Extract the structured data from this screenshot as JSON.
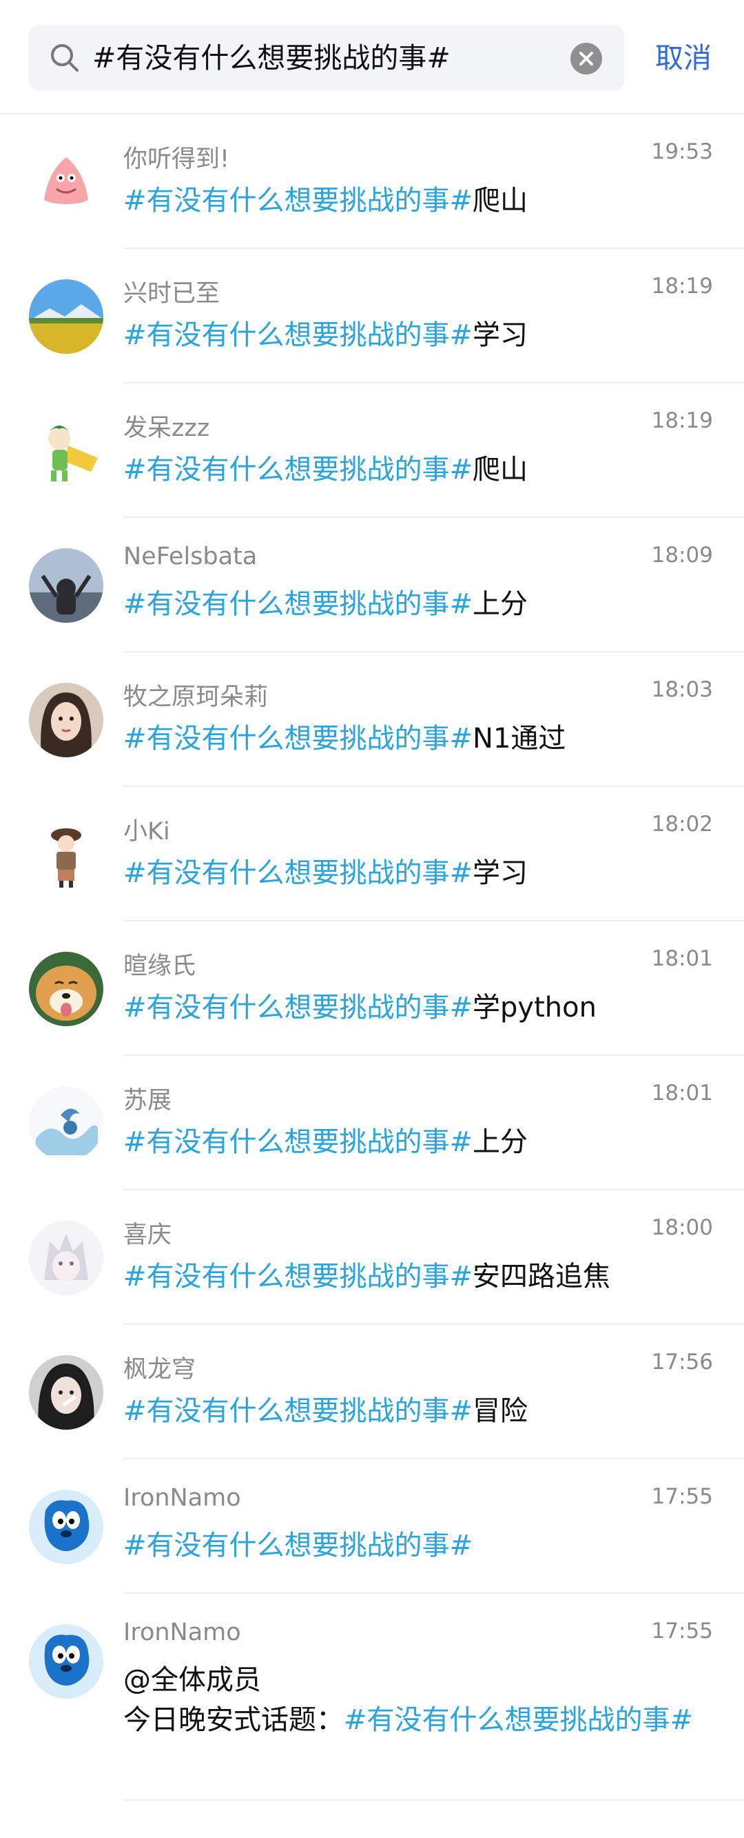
{
  "search": {
    "query": "#有没有什么想要挑战的事#",
    "cancel_label": "取消"
  },
  "messages": [
    {
      "name": "你听得到!",
      "time": "19:53",
      "topic": "#有没有什么想要挑战的事#",
      "text": "爬山",
      "avatar": "patrick-avatar"
    },
    {
      "name": "兴时已至",
      "time": "18:19",
      "topic": "#有没有什么想要挑战的事#",
      "text": "学习",
      "avatar": "landscape-avatar"
    },
    {
      "name": "发呆zzz",
      "time": "18:19",
      "topic": "#有没有什么想要挑战的事#",
      "text": "爬山",
      "avatar": "cartoon-avatar"
    },
    {
      "name": "NeFelsbata",
      "time": "18:09",
      "topic": "#有没有什么想要挑战的事#",
      "text": "上分",
      "avatar": "sky-avatar"
    },
    {
      "name": "牧之原珂朵莉",
      "time": "18:03",
      "topic": "#有没有什么想要挑战的事#",
      "text": "N1通过",
      "avatar": "girl-avatar"
    },
    {
      "name": "小Ki",
      "time": "18:02",
      "topic": "#有没有什么想要挑战的事#",
      "text": "学习",
      "avatar": "figure-avatar"
    },
    {
      "name": "暄缘氏",
      "time": "18:01",
      "topic": "#有没有什么想要挑战的事#",
      "text": "学python",
      "avatar": "dog-avatar"
    },
    {
      "name": "苏展",
      "time": "18:01",
      "topic": "#有没有什么想要挑战的事#",
      "text": "上分",
      "avatar": "wave-avatar"
    },
    {
      "name": "喜庆",
      "time": "18:00",
      "topic": "#有没有什么想要挑战的事#",
      "text": "安四路追焦",
      "avatar": "anime-avatar"
    },
    {
      "name": "枫龙穹",
      "time": "17:56",
      "topic": "#有没有什么想要挑战的事#",
      "text": "冒险",
      "avatar": "portrait-avatar"
    },
    {
      "name": "IronNamo",
      "time": "17:55",
      "topic": "#有没有什么想要挑战的事#",
      "text": "",
      "avatar": "blue-dog-avatar"
    },
    {
      "name": "IronNamo",
      "time": "17:55",
      "mention": "@全体成员",
      "prefix": "今日晚安式话题：",
      "topic": "#有没有什么想要挑战的事#",
      "text": "",
      "avatar": "blue-dog-avatar"
    }
  ],
  "colors": {
    "topic": "#2aa4dd",
    "cancel": "#2f6bd6",
    "meta": "#8a8a8a"
  }
}
